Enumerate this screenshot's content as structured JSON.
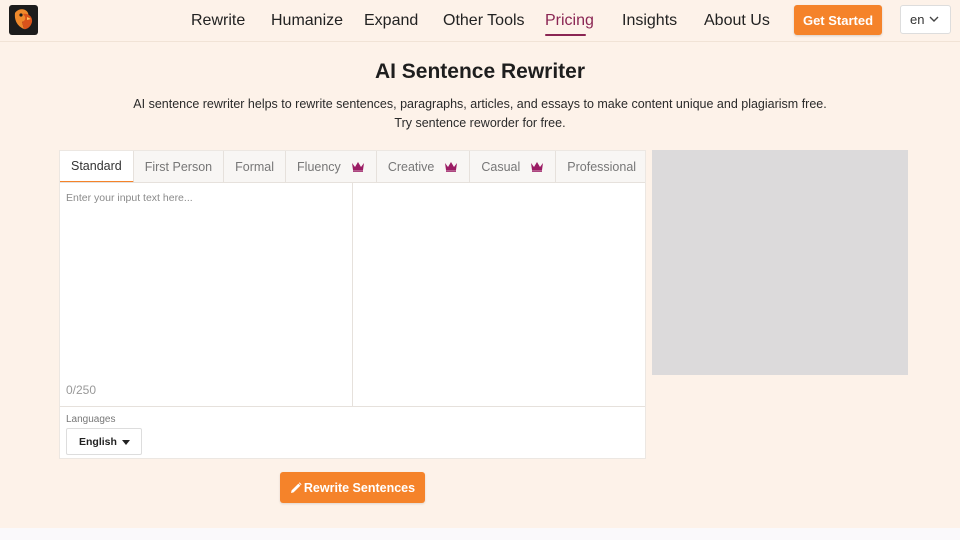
{
  "header": {
    "logo_icon": "parrot-logo-icon",
    "nav": [
      {
        "label": "Rewrite"
      },
      {
        "label": "Humanize"
      },
      {
        "label": "Expand"
      },
      {
        "label": "Other Tools"
      },
      {
        "label": "Pricing",
        "active": true
      },
      {
        "label": "Insights"
      },
      {
        "label": "About Us"
      }
    ],
    "cta_label": "Get Started",
    "language": "en"
  },
  "hero": {
    "title": "AI Sentence Rewriter",
    "subtitle": "AI sentence rewriter helps to rewrite sentences, paragraphs, articles, and essays to make content unique and plagiarism free. Try sentence reworder for free."
  },
  "tool": {
    "tabs": [
      {
        "label": "Standard",
        "active": true,
        "premium": false
      },
      {
        "label": "First Person",
        "premium": false
      },
      {
        "label": "Formal",
        "premium": false
      },
      {
        "label": "Fluency",
        "premium": true
      },
      {
        "label": "Creative",
        "premium": true
      },
      {
        "label": "Casual",
        "premium": true
      },
      {
        "label": "Professional",
        "premium": true
      }
    ],
    "input_placeholder": "Enter your input text here...",
    "counter": "0/250",
    "languages_label": "Languages",
    "language_value": "English",
    "rewrite_label": "Rewrite Sentences"
  },
  "colors": {
    "accent": "#f5832a",
    "active_nav": "#8a2553",
    "crown": "#9b1c64",
    "background": "#fdf2e9"
  }
}
